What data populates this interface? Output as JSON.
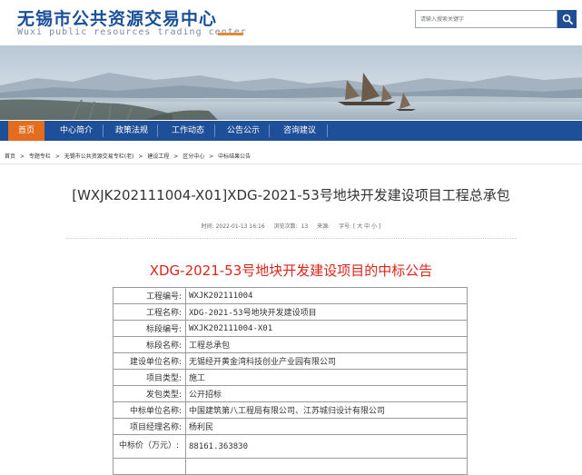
{
  "header": {
    "title_cn": "无锡市公共资源交易中心",
    "title_en": "Wuxi public resources trading center",
    "search_placeholder": "请输入搜索关键字"
  },
  "nav": {
    "items": [
      {
        "label": "首页",
        "active": true
      },
      {
        "label": "中心简介"
      },
      {
        "label": "政策法规"
      },
      {
        "label": "工作动态"
      },
      {
        "label": "公告公示"
      },
      {
        "label": "咨询建议"
      }
    ]
  },
  "breadcrumb": [
    "首页",
    ">",
    "专题专栏",
    ">",
    "无锡市公共资源交易专栏(老)",
    ">",
    "建设工程",
    ">",
    "区分中心",
    ">",
    "中标结果公告"
  ],
  "article": {
    "title": "[WXJK202111004-X01]XDG-2021-53号地块开发建设项目工程总承包",
    "time_label": "时间: 2022-01-13 16:16",
    "views_label": "浏览次数:",
    "views": "13",
    "source_label": "来源:",
    "font_label": "字号: [ 大 中 小 ]"
  },
  "notice": {
    "title": "XDG-2021-53号地块开发建设项目的中标公告",
    "rows": [
      {
        "label": "工程编号:",
        "value": "WXJK202111004"
      },
      {
        "label": "工程名称:",
        "value": "XDG-2021-53号地块开发建设项目"
      },
      {
        "label": "标段编号:",
        "value": "WXJK202111004-X01"
      },
      {
        "label": "标段名称:",
        "value": "工程总承包"
      },
      {
        "label": "建设单位名称:",
        "value": "无锡经开黄金湾科技创业产业园有限公司"
      },
      {
        "label": "项目类型:",
        "value": "施工"
      },
      {
        "label": "发包类型:",
        "value": "公开招标"
      },
      {
        "label": "中标单位名称:",
        "value": "中国建筑第八工程局有限公司、江苏城归设计有限公司"
      },
      {
        "label": "项目经理名称:",
        "value": "杨利民"
      },
      {
        "label": "中标价（万元）:",
        "value": "88161.363830"
      }
    ]
  },
  "colors": {
    "brand_blue": "#1e4f99",
    "active_orange": "#e46c1f",
    "notice_red": "#e0241b"
  }
}
